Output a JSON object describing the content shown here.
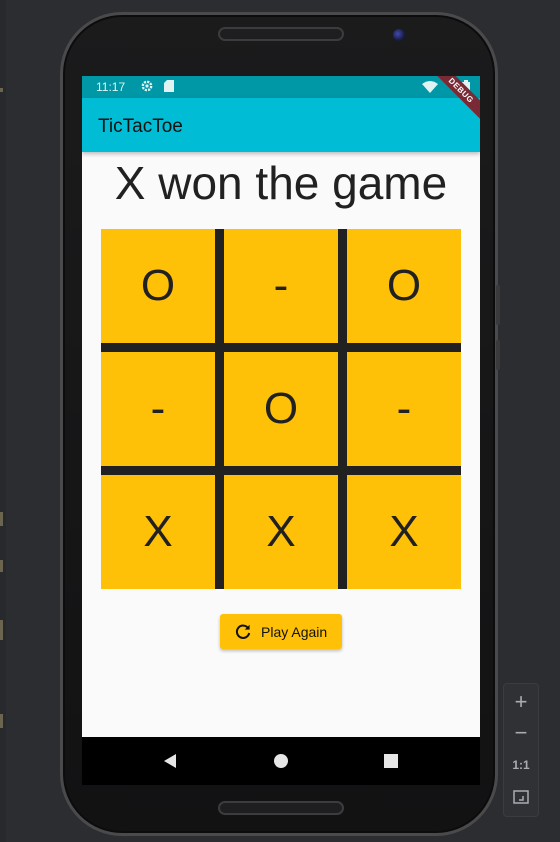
{
  "status_bar": {
    "time": "11:17",
    "icons": [
      "settings-gear-icon",
      "sd-card-icon",
      "wifi-icon",
      "battery-icon"
    ]
  },
  "debug_banner": "DEBUG",
  "app_bar": {
    "title": "TicTacToe"
  },
  "game": {
    "status": "X won the game",
    "board": [
      [
        "O",
        "-",
        "O"
      ],
      [
        "-",
        "O",
        "-"
      ],
      [
        "X",
        "X",
        "X"
      ]
    ]
  },
  "play_again": {
    "label": "Play Again",
    "icon": "refresh-icon"
  },
  "nav": {
    "icons": [
      "back-icon",
      "home-icon",
      "recents-icon"
    ]
  },
  "zoom_controls": {
    "zoom_in": "+",
    "zoom_out": "−",
    "actual_size": "1:1",
    "icons": [
      "zoom-in-icon",
      "zoom-out-icon",
      "fit-screen-icon"
    ]
  },
  "colors": {
    "status_bar": "#0097a7",
    "app_bar": "#00bcd4",
    "cell": "#ffc107",
    "board_lines": "#212121",
    "button": "#ffc107",
    "background": "#fafafa"
  }
}
